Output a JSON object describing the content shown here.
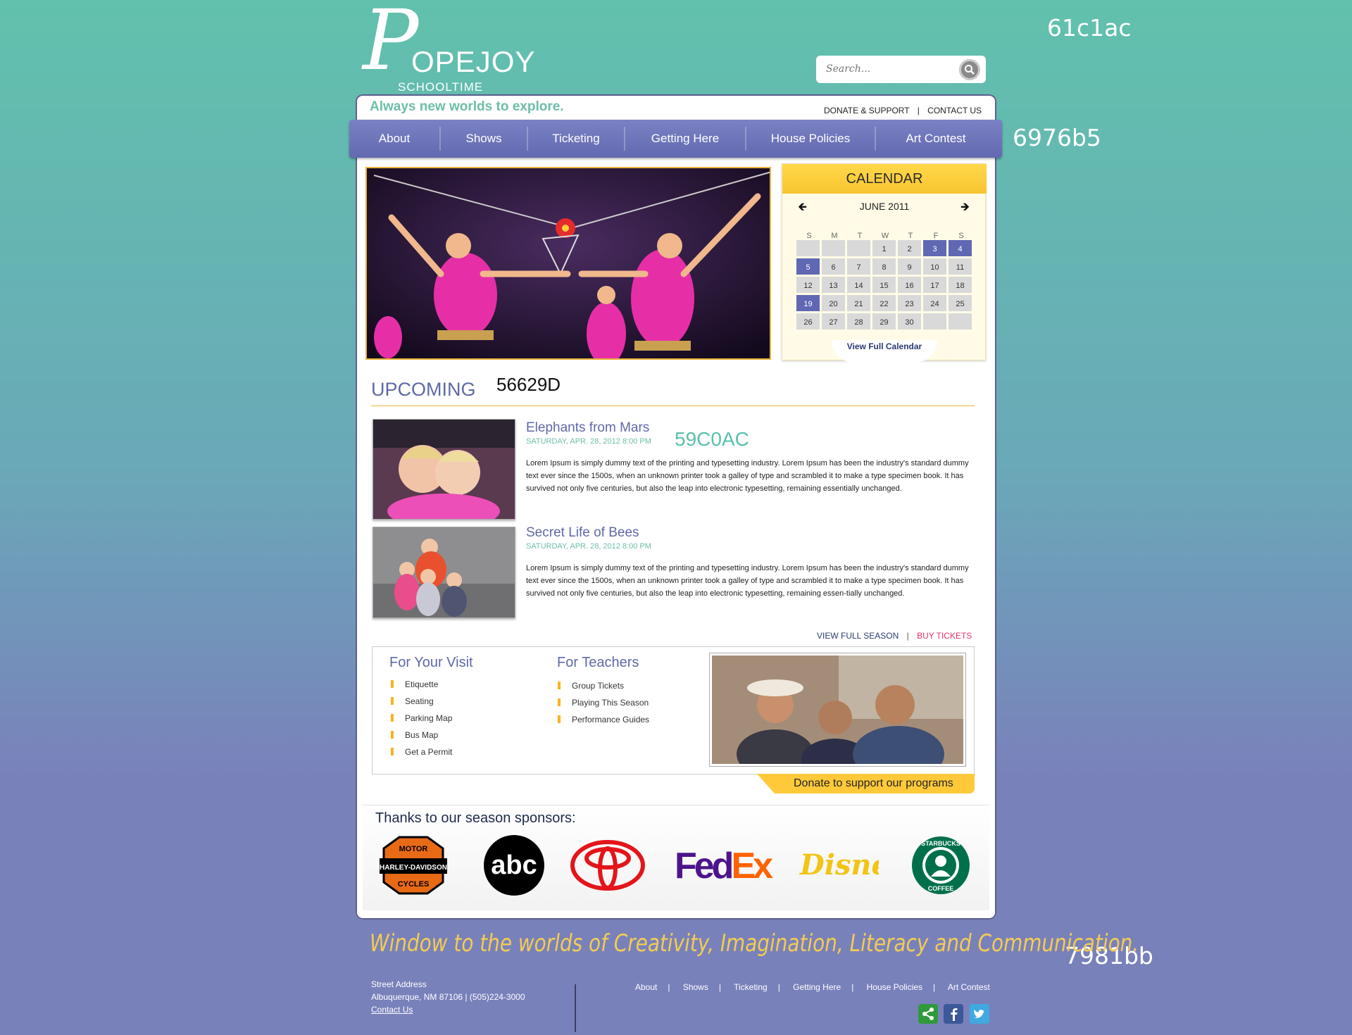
{
  "swatches": {
    "top": "61c1ac",
    "nav": "6976b5",
    "bottom": "7981bb"
  },
  "logo": {
    "name": "OPEJOY",
    "initial": "P",
    "subtitle": "SCHOOLTIME SERIES"
  },
  "search": {
    "placeholder": "Search..."
  },
  "header": {
    "tagline": "Always new worlds to explore.",
    "links": [
      "DONATE & SUPPORT",
      "CONTACT US"
    ],
    "separator": "|"
  },
  "nav": [
    "About",
    "Shows",
    "Ticketing",
    "Getting Here",
    "House Policies",
    "Art Contest"
  ],
  "calendar": {
    "title": "CALENDAR",
    "month": "JUNE 2011",
    "weekdays": [
      "S",
      "M",
      "T",
      "W",
      "T",
      "F",
      "S"
    ],
    "first_weekday_index": 3,
    "days_in_month": 30,
    "highlighted": [
      3,
      4,
      5,
      19
    ],
    "link": "View Full Calendar"
  },
  "upcoming": {
    "title": "UPCOMING",
    "code": "56629D",
    "events": [
      {
        "title": "Elephants from Mars",
        "date": "SATURDAY, APR. 28, 2012 8:00 PM",
        "code": "59C0AC",
        "description": "Lorem Ipsum is simply dummy text of the printing and typesetting industry. Lorem Ipsum has been the industry's standard dummy text ever since the 1500s, when an unknown printer took a galley of type and scrambled it to make a type specimen book. It has survived not only five centuries, but also the leap into electronic typesetting, remaining essentially unchanged."
      },
      {
        "title": "Secret Life of Bees",
        "date": "SATURDAY, APR. 28, 2012 8:00 PM",
        "description": "Lorem Ipsum is simply dummy text of the printing and typesetting industry. Lorem Ipsum has been the industry's standard dummy text ever since the 1500s, when an unknown printer took a galley of type and scrambled it to make a type specimen book. It has survived not only five centuries, but also the leap into electronic typesetting, remaining essen-tially unchanged."
      }
    ],
    "view_full_season": "VIEW FULL SEASON",
    "buy_tickets": "BUY TICKETS",
    "separator": "|"
  },
  "visit": {
    "title": "For Your Visit",
    "items": [
      "Etiquette",
      "Seating",
      "Parking Map",
      "Bus Map",
      "Get a Permit"
    ]
  },
  "teachers": {
    "title": "For Teachers",
    "items": [
      "Group Tickets",
      "Playing This Season",
      "Performance Guides"
    ]
  },
  "donate": "Donate to support our programs",
  "sponsors": {
    "title": "Thanks to our season sponsors:",
    "harley": {
      "line1": "MOTOR",
      "line2": "HARLEY-DAVIDSON",
      "line3": "CYCLES"
    },
    "abc": "abc",
    "fedex": {
      "fed": "Fed",
      "ex": "Ex"
    },
    "disney": "Disney",
    "starbucks": {
      "top": "STARBUCKS",
      "bottom": "COFFEE"
    }
  },
  "footer": {
    "slogan": "Window to the worlds of Creativity, Imagination, Literacy and Communication.",
    "address_line1": "Street Address",
    "address_line2": "Albuquerque, NM 87106 | (505)224-3000",
    "contact": "Contact Us",
    "nav": [
      "About",
      "Shows",
      "Ticketing",
      "Getting Here",
      "House Policies",
      "Art Contest"
    ],
    "separator": "|"
  },
  "colors": {
    "accent": "#6976b5",
    "teal": "#61c1ac",
    "gold": "#f8c530",
    "pink": "#e8336a"
  }
}
